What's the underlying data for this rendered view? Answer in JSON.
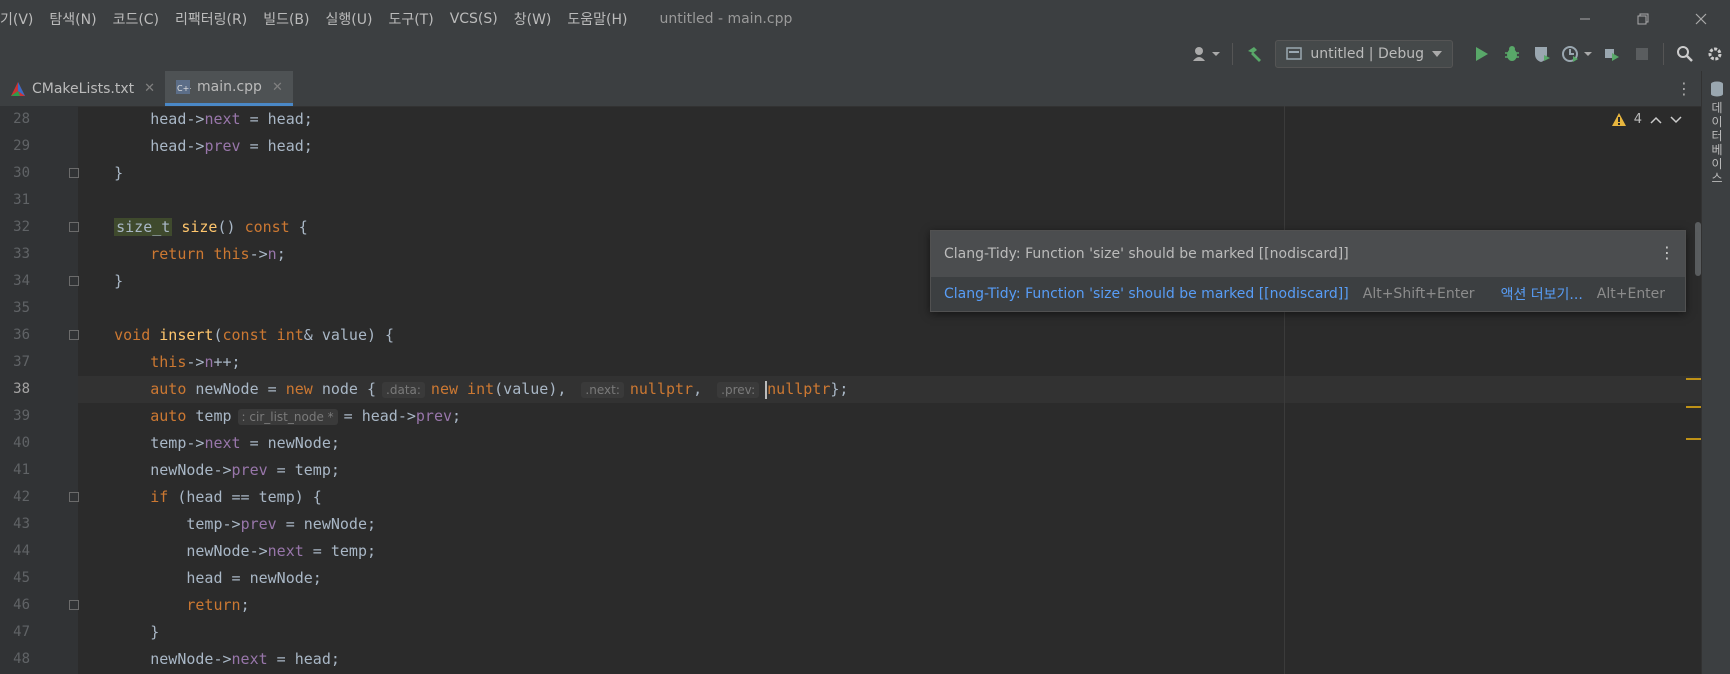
{
  "menubar": {
    "items": [
      "기(V)",
      "탐색(N)",
      "코드(C)",
      "리팩터링(R)",
      "빌드(B)",
      "실행(U)",
      "도구(T)",
      "VCS(S)",
      "창(W)",
      "도움말(H)"
    ],
    "title": "untitled - main.cpp"
  },
  "toolbar": {
    "run_config": "untitled | Debug"
  },
  "tabs": [
    {
      "label": "CMakeLists.txt",
      "active": false
    },
    {
      "label": "main.cpp",
      "active": true
    }
  ],
  "inspection": {
    "warning_count": "4"
  },
  "popup": {
    "message": "Clang-Tidy: Function 'size' should be marked [[nodiscard]]",
    "action_label": "Clang-Tidy: Function 'size' should be marked [[nodiscard]]",
    "action_shortcut": "Alt+Shift+Enter",
    "more_actions_label": "액션 더보기...",
    "more_actions_shortcut": "Alt+Enter"
  },
  "sidebar": {
    "database_label": "데이터베이스"
  },
  "hints": {
    "data": ".data:",
    "next": ".next:",
    "prev": ".prev:",
    "temp_type": ": cir_list_node *"
  },
  "code": {
    "line_numbers": [
      "28",
      "29",
      "30",
      "31",
      "32",
      "33",
      "34",
      "35",
      "36",
      "37",
      "38",
      "39",
      "40",
      "41",
      "42",
      "43",
      "44",
      "45",
      "46",
      "47",
      "48"
    ],
    "current_line": "38"
  }
}
